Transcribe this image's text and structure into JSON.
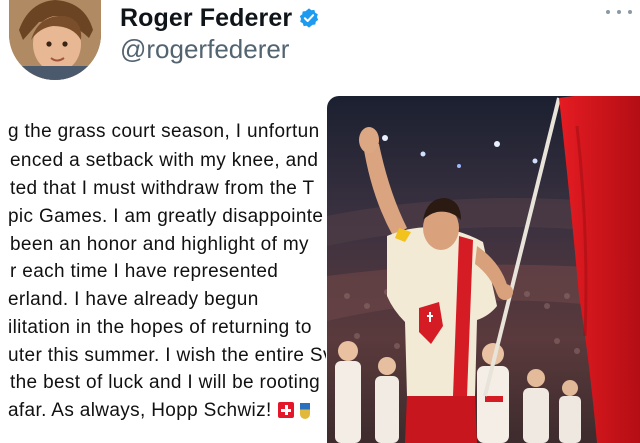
{
  "profile": {
    "display_name": "Roger Federer",
    "handle": "@rogerfederer",
    "verified": true,
    "avatar_icon": "child-portrait-avatar",
    "verified_icon": "verified-badge-icon",
    "more_icon": "more-options-icon",
    "accent_color": "#1d9bf0"
  },
  "tweet": {
    "lines": [
      "g the grass court season, I unfortun",
      "enced a setback with my knee, and",
      "ted that I must withdraw from the T",
      "pic Games. I am greatly disappointe",
      "been an honor and highlight of my",
      "r each time I have represented",
      "erland. I have already begun",
      "ilitation in the hopes of returning to",
      "uter this summer. I wish the entire Sv",
      "the best of luck and I will be rooting",
      "afar. As always, Hopp Schwiz!"
    ],
    "emojis": [
      "swiss-flag-emoji",
      "medal-emoji"
    ]
  },
  "media": {
    "photo_icon": "flag-bearer-stadium-photo",
    "flag_color": "#d8141e"
  }
}
